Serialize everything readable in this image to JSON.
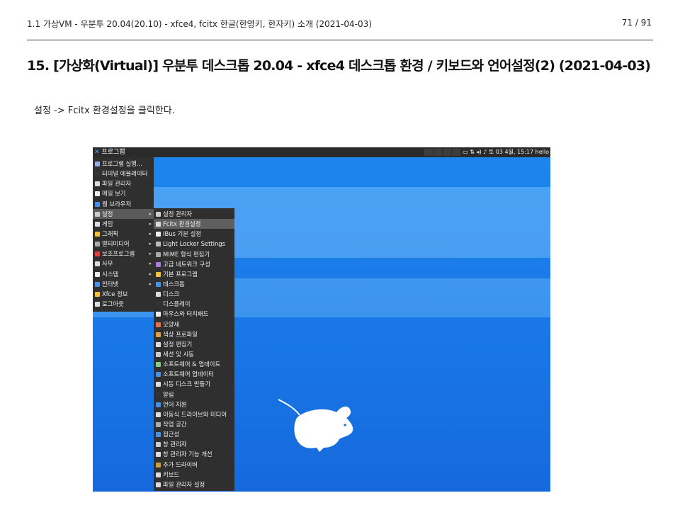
{
  "header": {
    "left": "1.1 가상VM - 우분투 20.04(20.10) - xfce4, fcitx 한글(한영키, 한자키) 소개 (2021-04-03)",
    "page": "71 / 91"
  },
  "title": "15. [가상화(Virtual)] 우분투 데스크톱 20.04 - xfce4 데스크톱 환경 / 키보드와 언어설정(2) (2021-04-03)",
  "body_text": "설정 -> Fcitx 환경설정을 클릭한다.",
  "screenshot": {
    "panel": {
      "start_label": "프로그램",
      "clock": "토 03 4월, 15:17",
      "user": "hello"
    },
    "main_menu": [
      {
        "label": "프로그램 실행...",
        "icon": "run-icon",
        "color": "#9ad"
      },
      {
        "label": "터미널 에뮬레이터",
        "icon": "terminal-icon",
        "color": "#333"
      },
      {
        "label": "파일 관리자",
        "icon": "folder-icon",
        "color": "#ddd"
      },
      {
        "label": "메일 보기",
        "icon": "mail-icon",
        "color": "#eee"
      },
      {
        "label": "웹 브라우저",
        "icon": "globe-icon",
        "color": "#4a90e2"
      },
      {
        "label": "설정",
        "icon": "settings-icon",
        "color": "#ccc",
        "arrow": true,
        "selected": true
      },
      {
        "label": "게임",
        "icon": "game-icon",
        "color": "#ddd",
        "arrow": true
      },
      {
        "label": "그래픽",
        "icon": "graphics-icon",
        "color": "#f0c040",
        "arrow": true
      },
      {
        "label": "멀티미디어",
        "icon": "multimedia-icon",
        "color": "#aaa",
        "arrow": true
      },
      {
        "label": "보조프로그램",
        "icon": "accessories-icon",
        "color": "#e04040",
        "arrow": true
      },
      {
        "label": "사무",
        "icon": "office-icon",
        "color": "#ddd",
        "arrow": true
      },
      {
        "label": "시스템",
        "icon": "system-icon",
        "color": "#eee",
        "arrow": true
      },
      {
        "label": "인터넷",
        "icon": "internet-icon",
        "color": "#4a90e2",
        "arrow": true
      },
      {
        "label": "Xfce 정보",
        "icon": "star-icon",
        "color": "#f0c040"
      },
      {
        "label": "로그아웃",
        "icon": "logout-icon",
        "color": "#ddd"
      }
    ],
    "settings_menu": [
      {
        "label": "설정 관리자",
        "icon": "settings-manager-icon",
        "color": "#ccc"
      },
      {
        "label": "Fcitx 환경설정",
        "icon": "fcitx-icon",
        "color": "#ddd",
        "selected": true
      },
      {
        "label": "IBus 기본 설정",
        "icon": "ibus-icon",
        "color": "#eee"
      },
      {
        "label": "Light Locker Settings",
        "icon": "lock-icon",
        "color": "#bbb"
      },
      {
        "label": "MIME 형식 편집기",
        "icon": "mime-icon",
        "color": "#aaa"
      },
      {
        "label": "고급 네트워크 구성",
        "icon": "network-icon",
        "color": "#b07ad8"
      },
      {
        "label": "기본 프로그램",
        "icon": "default-apps-icon",
        "color": "#f0c040"
      },
      {
        "label": "데스크톱",
        "icon": "desktop-icon",
        "color": "#4a90e2"
      },
      {
        "label": "디스크",
        "icon": "disk-icon",
        "color": "#ddd"
      },
      {
        "label": "디스플레이",
        "icon": "display-icon",
        "color": "#333"
      },
      {
        "label": "마우스와 터치패드",
        "icon": "mouse-icon",
        "color": "#eee"
      },
      {
        "label": "모양새",
        "icon": "appearance-icon",
        "color": "#e07050"
      },
      {
        "label": "색상 프로파일",
        "icon": "color-profile-icon",
        "color": "#e0a040"
      },
      {
        "label": "설정 편집기",
        "icon": "settings-editor-icon",
        "color": "#ddd"
      },
      {
        "label": "세션 및 시동",
        "icon": "session-icon",
        "color": "#ccc"
      },
      {
        "label": "소프트웨어 & 업데이트",
        "icon": "software-icon",
        "color": "#8c8"
      },
      {
        "label": "소프트웨어 업데이터",
        "icon": "updater-icon",
        "color": "#4a90e2"
      },
      {
        "label": "시동 디스크 만들기",
        "icon": "startup-disk-icon",
        "color": "#ddd"
      },
      {
        "label": "알림",
        "icon": "notification-icon",
        "color": "#333"
      },
      {
        "label": "언어 지원",
        "icon": "language-icon",
        "color": "#4a90e2"
      },
      {
        "label": "이동식 드라이브와 미디어",
        "icon": "removable-icon",
        "color": "#ddd"
      },
      {
        "label": "작업 공간",
        "icon": "workspace-icon",
        "color": "#aaa"
      },
      {
        "label": "접근성",
        "icon": "accessibility-icon",
        "color": "#4a90e2"
      },
      {
        "label": "창 관리자",
        "icon": "window-manager-icon",
        "color": "#ccc"
      },
      {
        "label": "창 관리자 기능 개선",
        "icon": "window-tweaks-icon",
        "color": "#ddd"
      },
      {
        "label": "추가 드라이버",
        "icon": "driver-icon",
        "color": "#c8a040"
      },
      {
        "label": "키보드",
        "icon": "keyboard-icon",
        "color": "#ddd"
      },
      {
        "label": "파일 관리자 설정",
        "icon": "file-manager-settings-icon",
        "color": "#ddd"
      }
    ]
  }
}
